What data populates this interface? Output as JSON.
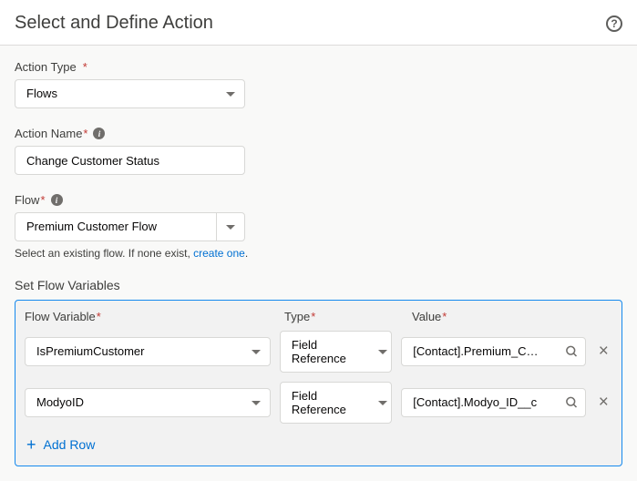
{
  "header": {
    "title": "Select and Define Action"
  },
  "fields": {
    "actionType": {
      "label": "Action Type",
      "value": "Flows"
    },
    "actionName": {
      "label": "Action Name",
      "value": "Change Customer Status"
    },
    "flow": {
      "label": "Flow",
      "value": "Premium Customer Flow",
      "helper_prefix": "Select an existing flow. If none exist, ",
      "helper_link": "create one",
      "helper_suffix": "."
    }
  },
  "variablesSection": {
    "title": "Set Flow Variables",
    "headers": {
      "variable": "Flow Variable",
      "type": "Type",
      "value": "Value"
    },
    "rows": [
      {
        "variable": "IsPremiumCustomer",
        "type": "Field Reference",
        "value": "[Contact].Premium_C…"
      },
      {
        "variable": "ModyoID",
        "type": "Field Reference",
        "value": "[Contact].Modyo_ID__c"
      }
    ],
    "addRow": "Add Row"
  }
}
